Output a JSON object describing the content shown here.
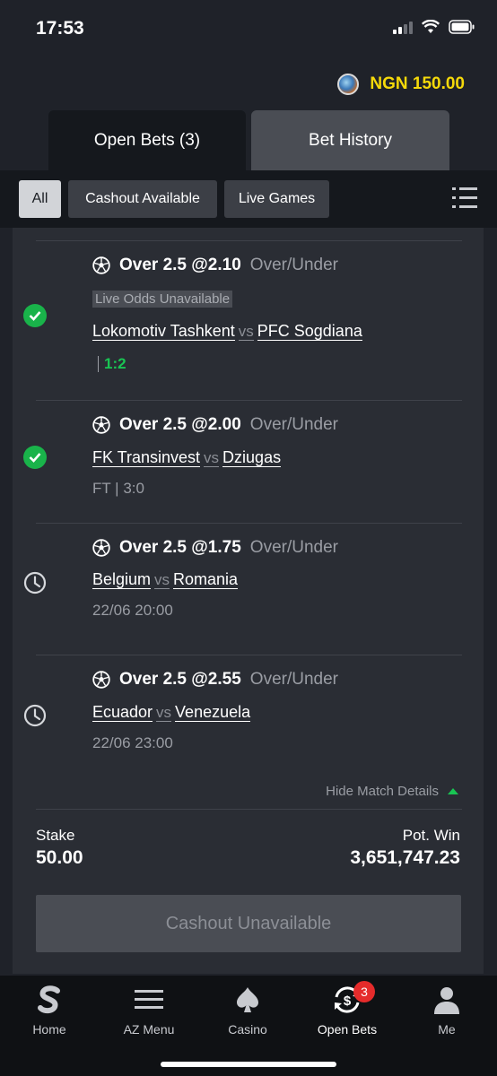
{
  "status_bar": {
    "time": "17:53"
  },
  "balance": {
    "amount": "NGN 150.00"
  },
  "tabs": [
    {
      "label": "Open Bets (3)",
      "active": true
    },
    {
      "label": "Bet History",
      "active": false
    }
  ],
  "filters": [
    {
      "label": "All",
      "active": true
    },
    {
      "label": "Cashout Available",
      "active": false
    },
    {
      "label": "Live Games",
      "active": false
    }
  ],
  "bets": [
    {
      "status_icon": "check-icon",
      "pick": "Over 2.5 @2.10",
      "market": "Over/Under",
      "notice": "Live Odds Unavailable",
      "home": "Lokomotiv Tashkent",
      "vs": "vs",
      "away": "PFC Sogdiana",
      "score": "1:2"
    },
    {
      "status_icon": "check-icon",
      "pick": "Over 2.5 @2.00",
      "market": "Over/Under",
      "home": "FK Transinvest",
      "vs": "vs",
      "away": "Dziugas",
      "meta": "FT | 3:0"
    },
    {
      "status_icon": "clock-icon",
      "pick": "Over 2.5 @1.75",
      "market": "Over/Under",
      "home": "Belgium",
      "vs": "vs",
      "away": "Romania",
      "meta": "22/06 20:00"
    },
    {
      "status_icon": "clock-icon",
      "pick": "Over 2.5 @2.55",
      "market": "Over/Under",
      "home": "Ecuador",
      "vs": "vs",
      "away": "Venezuela",
      "meta": "22/06 23:00"
    }
  ],
  "details_toggle": "Hide Match Details",
  "summary": {
    "stake_label": "Stake",
    "stake_value": "50.00",
    "win_label": "Pot. Win",
    "win_value": "3,651,747.23"
  },
  "cashout_label": "Cashout Unavailable",
  "nav": [
    {
      "label": "Home",
      "icon": "sportybet-logo-icon"
    },
    {
      "label": "AZ Menu",
      "icon": "menu-icon"
    },
    {
      "label": "Casino",
      "icon": "spade-icon"
    },
    {
      "label": "Open Bets",
      "icon": "cashout-icon",
      "badge": "3",
      "active": true
    },
    {
      "label": "Me",
      "icon": "user-icon"
    }
  ],
  "colors": {
    "background": "#1f2229",
    "card": "#2a2d34",
    "accent_green": "#19c553",
    "balance_yellow": "#f5d90a",
    "badge_red": "#e52b2b"
  }
}
